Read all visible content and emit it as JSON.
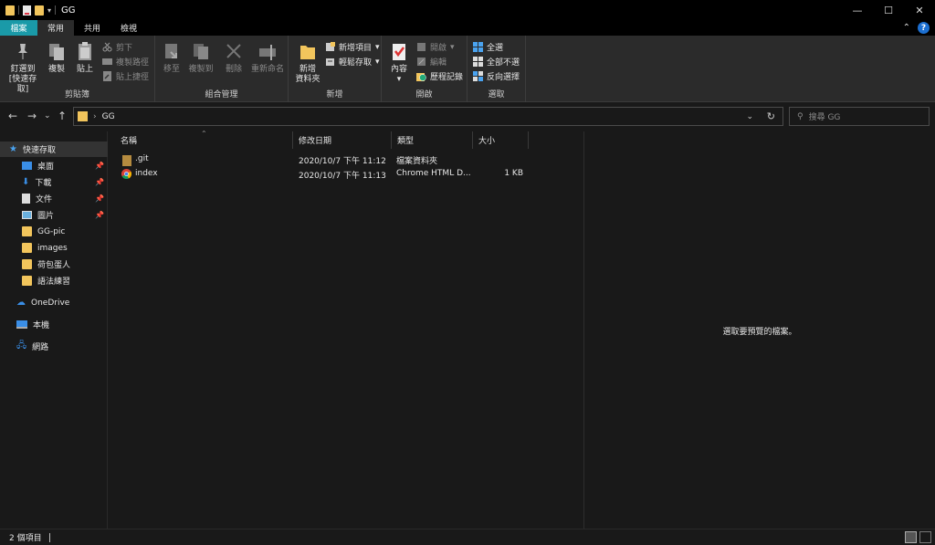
{
  "window": {
    "title": "GG",
    "controls": [
      "—",
      "☐",
      "✕"
    ]
  },
  "tabs": {
    "file": "檔案",
    "home": "常用",
    "share": "共用",
    "view": "檢視"
  },
  "ribbon": {
    "clipboard": {
      "label": "剪貼簿",
      "pin": "釘選到 [快速存取]",
      "copy": "複製",
      "paste": "貼上",
      "cut": "剪下",
      "copy_path": "複製路徑",
      "paste_shortcut": "貼上捷徑"
    },
    "organize": {
      "label": "組合管理",
      "move_to": "移至",
      "copy_to": "複製到",
      "delete": "刪除",
      "rename": "重新命名"
    },
    "new": {
      "label": "新增",
      "new_folder": "新增\n資料夾",
      "new_item": "新增項目",
      "easy_access": "輕鬆存取"
    },
    "open": {
      "label": "開啟",
      "properties": "內容",
      "open": "開啟",
      "edit": "編輯",
      "history": "歷程記錄"
    },
    "select": {
      "label": "選取",
      "select_all": "全選",
      "select_none": "全部不選",
      "invert": "反向選擇"
    }
  },
  "address": {
    "path": "GG",
    "search_placeholder": "搜尋 GG"
  },
  "nav": {
    "quick_access": "快速存取",
    "items": [
      {
        "label": "桌面",
        "pinned": true
      },
      {
        "label": "下載",
        "pinned": true
      },
      {
        "label": "文件",
        "pinned": true
      },
      {
        "label": "圖片",
        "pinned": true
      },
      {
        "label": "GG-pic",
        "pinned": false
      },
      {
        "label": "images",
        "pinned": false
      },
      {
        "label": "荷包蛋人",
        "pinned": false
      },
      {
        "label": "語法練習",
        "pinned": false
      }
    ],
    "onedrive": "OneDrive",
    "this_pc": "本機",
    "network": "網路"
  },
  "columns": {
    "name": "名稱",
    "modified": "修改日期",
    "type": "類型",
    "size": "大小"
  },
  "files": [
    {
      "name": ".git",
      "modified": "2020/10/7 下午 11:12",
      "type": "檔案資料夾",
      "size": ""
    },
    {
      "name": "index",
      "modified": "2020/10/7 下午 11:13",
      "type": "Chrome HTML D...",
      "size": "1 KB"
    }
  ],
  "preview": {
    "message": "選取要預覽的檔案。"
  },
  "status": {
    "count": "2 個項目"
  }
}
